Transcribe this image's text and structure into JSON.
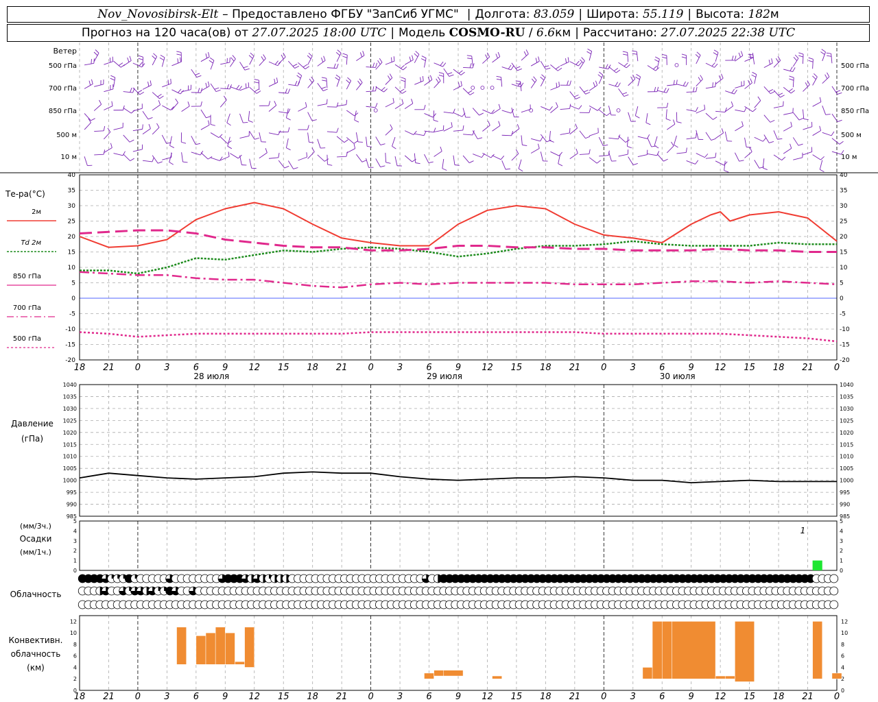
{
  "header": {
    "station": "Nov_Novosibirsk-Elt",
    "provider": "– Предоставлено ФГБУ \"ЗапСиб УГМС\"",
    "lon_label": "Долгота:",
    "lon_value": "83.059",
    "lat_label": "Широта:",
    "lat_value": "55.119",
    "alt_label": "Высота:",
    "alt_value": "182",
    "alt_unit": "м",
    "forecast_label": "Прогноз на 120 часа(ов) от",
    "forecast_start": "27.07.2025 18:00 UTC",
    "model_label": "Модель",
    "model_name": "COSMO-RU",
    "model_res_value": "6.6",
    "model_res_unit": "км",
    "computed_label": "Рассчитано:",
    "computed_time": "27.07.2025 22:38 UTC"
  },
  "chart_data": [
    {
      "type": "wind-barbs",
      "panel_title": "Ветер",
      "levels": [
        "500 гПа",
        "700 гПа",
        "850 гПа",
        "500 м",
        "10 м"
      ],
      "calm_symbols_note": "circles indicate calm"
    },
    {
      "type": "line",
      "ylabel": "Те-ра(°C)",
      "ylim": [
        -20,
        40
      ],
      "yticks": [
        40,
        35,
        30,
        25,
        20,
        15,
        10,
        5,
        0,
        -5,
        -10,
        -15,
        -20
      ],
      "x_ticks": [
        "18",
        "21",
        "0",
        "3",
        "6",
        "9",
        "12",
        "15",
        "18",
        "21",
        "0",
        "3",
        "6",
        "9",
        "12",
        "15",
        "18",
        "21",
        "0",
        "3",
        "6",
        "9",
        "12",
        "15",
        "18",
        "21",
        "0"
      ],
      "x_hours": [
        0,
        3,
        6,
        9,
        12,
        15,
        18,
        21,
        24,
        27,
        30,
        33,
        36,
        39,
        42,
        45,
        48,
        51,
        54,
        57,
        60,
        63,
        66,
        69,
        72,
        75,
        78
      ],
      "day_labels": [
        "28 июля",
        "29 июля",
        "30 июля"
      ],
      "series": [
        {
          "name": "2м",
          "color": "#f03c32",
          "x": [
            0,
            3,
            6,
            9,
            12,
            15,
            18,
            21,
            24,
            27,
            30,
            33,
            36,
            39,
            42,
            45,
            48,
            51,
            54,
            57,
            60,
            63,
            65,
            66,
            67,
            69,
            72,
            75,
            78
          ],
          "y": [
            20,
            16.5,
            17,
            19,
            25.5,
            29,
            31,
            29,
            24,
            19.5,
            18,
            17,
            17,
            24,
            28.5,
            30,
            29,
            24,
            20.5,
            19.5,
            18,
            24,
            27,
            28,
            25,
            27,
            28,
            26,
            18.5
          ]
        },
        {
          "name": "Td 2м",
          "color": "#1e8c1e",
          "x": [
            0,
            3,
            6,
            9,
            12,
            15,
            18,
            21,
            24,
            27,
            30,
            33,
            36,
            39,
            42,
            45,
            48,
            51,
            54,
            57,
            60,
            63,
            66,
            69,
            72,
            75,
            78
          ],
          "y": [
            9,
            9,
            8,
            10,
            13,
            12.5,
            14,
            15.5,
            15,
            16,
            16.5,
            16,
            15,
            13.5,
            14.5,
            16,
            17,
            17,
            17.5,
            18.5,
            17.5,
            17,
            17,
            17,
            18,
            17.5,
            17.5
          ]
        },
        {
          "name": "850 гПа",
          "color": "#e0288c",
          "x": [
            0,
            3,
            6,
            9,
            12,
            15,
            18,
            21,
            24,
            27,
            30,
            33,
            36,
            39,
            42,
            45,
            48,
            51,
            54,
            57,
            60,
            63,
            66,
            69,
            72,
            75,
            78
          ],
          "y": [
            21,
            21.5,
            22,
            22,
            21,
            19,
            18,
            17,
            16.5,
            16.5,
            15.5,
            15.5,
            16,
            17,
            17,
            16.5,
            16.5,
            16,
            16,
            15.5,
            15.5,
            15.5,
            16,
            15.5,
            15.5,
            15,
            15
          ]
        },
        {
          "name": "700 гПа",
          "color": "#e0288c",
          "x": [
            0,
            3,
            6,
            9,
            12,
            15,
            18,
            21,
            24,
            27,
            30,
            33,
            36,
            39,
            42,
            45,
            48,
            51,
            54,
            57,
            60,
            63,
            66,
            69,
            72,
            75,
            78
          ],
          "y": [
            8.5,
            8,
            7.5,
            7.5,
            6.5,
            6,
            6,
            5,
            4,
            3.5,
            4.5,
            5,
            4.5,
            5,
            5,
            5,
            5,
            4.5,
            4.5,
            4.5,
            5,
            5.5,
            5.5,
            5,
            5.5,
            5,
            4.5
          ]
        },
        {
          "name": "500 гПа",
          "color": "#e0288c",
          "x": [
            0,
            3,
            6,
            9,
            12,
            15,
            18,
            21,
            24,
            27,
            30,
            33,
            36,
            39,
            42,
            45,
            48,
            51,
            54,
            57,
            60,
            63,
            66,
            69,
            72,
            75,
            78
          ],
          "y": [
            -11,
            -11.5,
            -12.5,
            -12,
            -11.5,
            -11.5,
            -11.5,
            -11.5,
            -11.5,
            -11.5,
            -11,
            -11,
            -11,
            -11,
            -11,
            -11,
            -11,
            -11,
            -11.5,
            -11.5,
            -11.5,
            -11.5,
            -11.5,
            -12,
            -12.5,
            -13,
            -14
          ]
        }
      ]
    },
    {
      "type": "line",
      "ylabel": "Давление",
      "yunit": "(гПа)",
      "ylim": [
        985,
        1040
      ],
      "yticks": [
        1040,
        1035,
        1030,
        1025,
        1020,
        1015,
        1010,
        1005,
        1000,
        995,
        990,
        985
      ],
      "series": [
        {
          "name": "",
          "color": "#000000",
          "x": [
            0,
            3,
            6,
            9,
            12,
            15,
            18,
            21,
            24,
            27,
            30,
            33,
            36,
            39,
            42,
            45,
            48,
            51,
            54,
            57,
            60,
            63,
            66,
            69,
            72,
            75,
            78
          ],
          "y": [
            1001,
            1003,
            1002,
            1001,
            1000.5,
            1001,
            1001.5,
            1003,
            1003.5,
            1003,
            1003,
            1001.5,
            1000.5,
            1000,
            1000.5,
            1001,
            1001,
            1001.5,
            1001,
            1000,
            1000,
            999,
            999.5,
            1000,
            999.5,
            999.5,
            999.5
          ]
        }
      ]
    },
    {
      "type": "bar",
      "ylabel": "Осадки",
      "yunit_3h": "(мм/3ч.)",
      "yunit_1h": "(мм/1ч.)",
      "ylim": [
        0,
        5
      ],
      "yticks": [
        5,
        4,
        3,
        2,
        1,
        0
      ],
      "bars": [
        {
          "x": 76,
          "value": 1,
          "color": "#1ee632"
        }
      ],
      "annotation": {
        "x": 74.5,
        "text": "1"
      }
    },
    {
      "type": "cloud-cover",
      "ylabel": "Облачность",
      "rows": 3,
      "levels_0_4": [
        [
          4,
          4,
          4,
          4,
          3,
          1,
          1,
          1,
          4,
          1,
          0,
          0,
          0,
          0,
          0,
          3,
          0,
          0,
          0,
          0,
          0,
          0,
          0,
          0,
          3,
          4,
          4,
          4,
          3,
          2,
          3,
          2,
          1,
          2,
          2,
          2,
          0,
          0,
          0,
          0,
          0,
          0,
          0,
          0,
          0,
          0,
          0,
          0,
          0,
          0,
          0,
          0,
          0,
          0,
          0,
          0,
          0,
          0,
          0,
          3,
          0,
          2,
          4,
          4,
          4,
          4,
          4,
          4,
          4,
          4,
          4,
          4,
          4,
          4,
          4,
          4,
          4,
          4,
          4,
          4,
          4,
          4,
          4,
          4,
          4,
          4,
          4,
          4,
          4,
          4,
          4,
          4,
          4,
          4,
          4,
          4,
          4,
          4,
          4,
          4,
          4,
          4,
          4,
          4,
          4,
          4,
          4,
          4,
          4,
          4,
          4,
          4,
          4,
          4,
          4,
          4,
          4,
          4,
          4,
          4,
          4,
          4,
          4,
          4,
          4,
          4
        ],
        [
          0,
          0,
          0,
          2,
          3,
          0,
          0,
          3,
          1,
          3,
          3,
          2,
          3,
          1,
          1,
          4,
          3,
          0,
          0,
          3,
          0,
          0,
          0,
          0,
          0,
          0,
          0,
          0,
          0,
          0,
          0,
          0,
          0,
          0,
          0,
          0,
          0,
          0,
          0,
          0,
          0,
          0,
          0,
          0,
          0,
          0,
          0,
          0,
          0,
          0,
          0,
          0,
          0,
          0,
          0,
          0,
          0,
          0,
          0,
          0,
          0,
          0,
          0,
          0,
          0,
          0,
          0,
          0,
          0,
          0,
          0,
          0,
          0,
          0,
          0,
          0,
          0,
          0,
          0,
          0,
          0,
          0,
          0,
          0,
          0,
          0,
          0,
          0,
          0,
          0,
          0,
          0,
          0,
          0,
          0,
          0,
          0,
          0,
          0,
          0,
          0,
          0,
          0,
          0,
          0,
          0,
          0,
          0,
          0,
          0,
          0,
          0,
          0,
          0,
          0,
          0,
          0,
          0,
          0,
          0,
          0,
          0,
          0,
          0,
          0,
          0,
          0,
          0,
          0,
          0
        ],
        [
          0,
          0,
          0,
          0,
          0,
          0,
          0,
          0,
          0,
          0,
          0,
          0,
          0,
          0,
          0,
          0,
          0,
          0,
          0,
          0,
          0,
          0,
          0,
          0,
          0,
          0,
          0,
          0,
          0,
          0,
          0,
          0,
          0,
          0,
          0,
          0,
          0,
          0,
          0,
          0,
          0,
          0,
          0,
          0,
          0,
          0,
          0,
          0,
          0,
          0,
          0,
          0,
          0,
          0,
          0,
          0,
          0,
          0,
          0,
          0,
          0,
          0,
          0,
          0,
          0,
          0,
          0,
          0,
          0,
          0,
          0,
          0,
          0,
          0,
          0,
          0,
          0,
          0,
          0,
          0,
          0,
          0,
          0,
          0,
          0,
          0,
          0,
          0,
          0,
          0,
          0,
          0,
          0,
          0,
          0,
          0,
          0,
          0,
          0,
          0,
          0,
          0,
          0,
          0,
          0,
          0,
          0,
          0,
          0,
          0,
          0,
          0,
          0,
          0,
          0,
          0,
          0,
          0,
          0,
          0,
          0,
          0,
          0,
          0,
          0,
          0,
          0,
          0,
          0,
          0
        ]
      ]
    },
    {
      "type": "bar",
      "ylabel_lines": [
        "Конвективн.",
        "облачность",
        "(км)"
      ],
      "ylim": [
        0,
        13
      ],
      "yticks": [
        12,
        10,
        8,
        6,
        4,
        2,
        0
      ],
      "color": "#f08c32",
      "bars": [
        {
          "x0": 10,
          "x1": 11,
          "base": 4.5,
          "top": 11
        },
        {
          "x0": 12,
          "x1": 13,
          "base": 4.5,
          "top": 9.5
        },
        {
          "x0": 13,
          "x1": 14,
          "base": 4.5,
          "top": 10
        },
        {
          "x0": 14,
          "x1": 15,
          "base": 4.5,
          "top": 11
        },
        {
          "x0": 15,
          "x1": 16,
          "base": 4.5,
          "top": 10
        },
        {
          "x0": 16,
          "x1": 17,
          "base": 4.5,
          "top": 5
        },
        {
          "x0": 17,
          "x1": 18,
          "base": 4,
          "top": 11
        },
        {
          "x0": 35.5,
          "x1": 36.5,
          "base": 2,
          "top": 3
        },
        {
          "x0": 36.5,
          "x1": 37.5,
          "base": 2.5,
          "top": 3.5
        },
        {
          "x0": 37.5,
          "x1": 39.5,
          "base": 2.5,
          "top": 3.5
        },
        {
          "x0": 42.5,
          "x1": 43.5,
          "base": 2,
          "top": 2.5
        },
        {
          "x0": 58,
          "x1": 59,
          "base": 2,
          "top": 4
        },
        {
          "x0": 59,
          "x1": 60,
          "base": 2,
          "top": 12
        },
        {
          "x0": 60,
          "x1": 61,
          "base": 2,
          "top": 12
        },
        {
          "x0": 61,
          "x1": 65.5,
          "base": 2,
          "top": 12
        },
        {
          "x0": 65.5,
          "x1": 66.5,
          "base": 2,
          "top": 2.5
        },
        {
          "x0": 66.5,
          "x1": 67.5,
          "base": 2,
          "top": 2.5
        },
        {
          "x0": 67.5,
          "x1": 69.5,
          "base": 1.5,
          "top": 12
        },
        {
          "x0": 75.5,
          "x1": 76.5,
          "base": 2,
          "top": 12
        },
        {
          "x0": 77.5,
          "x1": 78.5,
          "base": 2,
          "top": 3
        }
      ]
    }
  ]
}
